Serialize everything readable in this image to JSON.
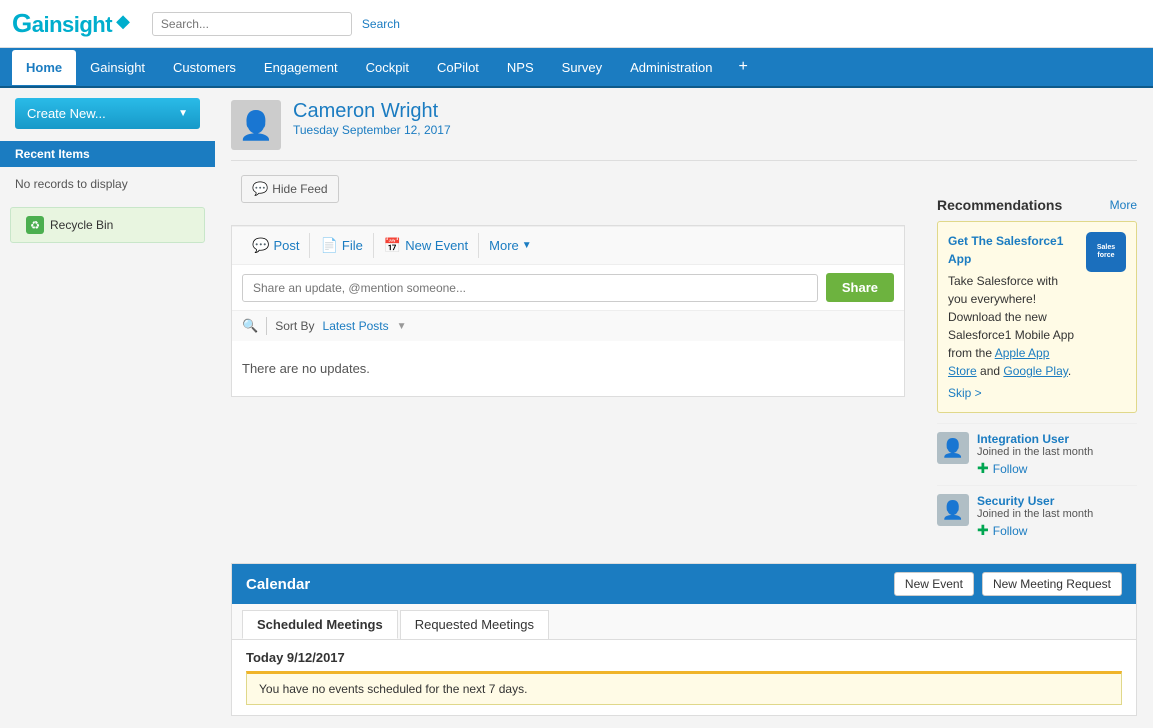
{
  "logo": {
    "text": "Gainsight"
  },
  "search": {
    "placeholder": "Search...",
    "button_label": "Search"
  },
  "nav": {
    "items": [
      {
        "label": "Home",
        "active": true
      },
      {
        "label": "Gainsight",
        "active": false
      },
      {
        "label": "Customers",
        "active": false
      },
      {
        "label": "Engagement",
        "active": false
      },
      {
        "label": "Cockpit",
        "active": false
      },
      {
        "label": "CoPilot",
        "active": false
      },
      {
        "label": "NPS",
        "active": false
      },
      {
        "label": "Survey",
        "active": false
      },
      {
        "label": "Administration",
        "active": false
      }
    ],
    "plus_label": "+"
  },
  "sidebar": {
    "create_new_label": "Create New...",
    "recent_items_label": "Recent Items",
    "no_records_label": "No records to display",
    "recycle_bin_label": "Recycle Bin"
  },
  "profile": {
    "name": "Cameron Wright",
    "date": "Tuesday September 12, 2017"
  },
  "feed": {
    "hide_feed_label": "Hide Feed",
    "toolbar": {
      "post_label": "Post",
      "file_label": "File",
      "new_event_label": "New Event",
      "more_label": "More"
    },
    "share_placeholder": "Share an update, @mention someone...",
    "share_button_label": "Share",
    "sort_label": "Sort By",
    "sort_value": "Latest Posts",
    "no_updates_text": "There are no updates."
  },
  "recommendations": {
    "title": "Recommendations",
    "more_label": "More",
    "banner": {
      "title": "Get The Salesforce1 App",
      "text": "Take Salesforce with you everywhere! Download the new Salesforce1 Mobile App from the",
      "link1": "Apple App Store",
      "text2": "and",
      "link2": "Google Play",
      "skip_label": "Skip >"
    },
    "users": [
      {
        "name": "Integration User",
        "sub": "Joined in the last month",
        "follow_label": "Follow"
      },
      {
        "name": "Security User",
        "sub": "Joined in the last month",
        "follow_label": "Follow"
      }
    ]
  },
  "calendar": {
    "title": "Calendar",
    "new_event_label": "New Event",
    "new_meeting_request_label": "New Meeting Request",
    "tabs": [
      {
        "label": "Scheduled Meetings",
        "active": true
      },
      {
        "label": "Requested Meetings",
        "active": false
      }
    ],
    "today_label": "Today 9/12/2017",
    "no_events_text": "You have no events scheduled for the next 7 days."
  }
}
